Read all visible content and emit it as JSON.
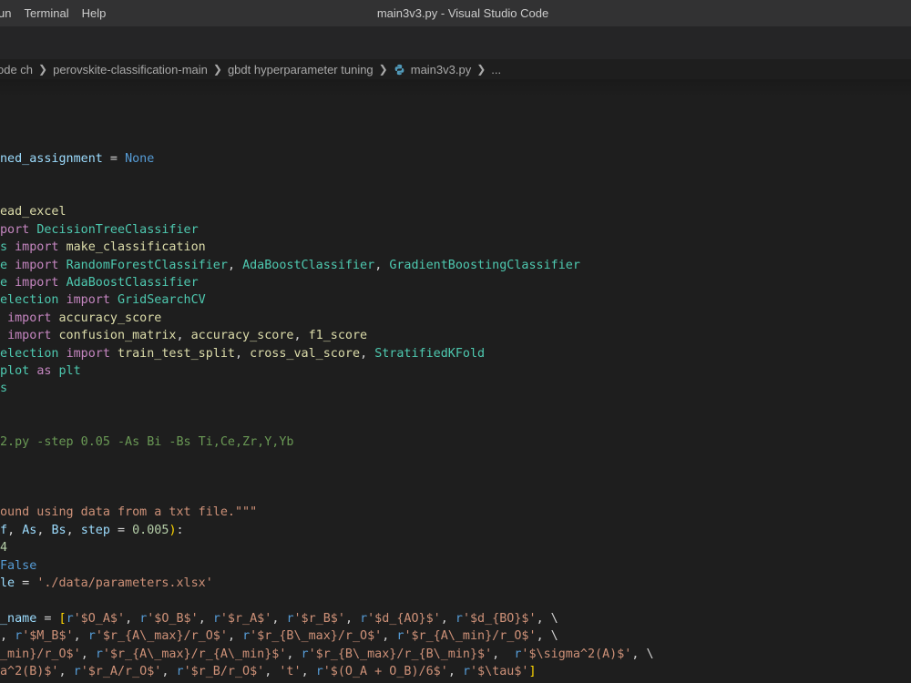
{
  "menu": {
    "items": [
      "un",
      "Terminal",
      "Help"
    ]
  },
  "window": {
    "title": "main3v3.py - Visual Studio Code"
  },
  "breadcrumb": {
    "items": [
      "ode ch",
      "perovskite-classification-main",
      "gbdt hyperparameter tuning",
      "main3v3.py",
      "..."
    ],
    "file_icon": "python-icon"
  },
  "colors": {
    "background": "#1e1e1e",
    "titlebar": "#323233",
    "keyword": "#c586c0",
    "class": "#4ec9b0",
    "string": "#ce9178",
    "number": "#b5cea8",
    "comment": "#6a9955",
    "constant": "#569cd6",
    "variable": "#9cdcfe",
    "function": "#dcdcaa"
  },
  "code": {
    "l1": [
      "ned_assignment",
      " = ",
      "None"
    ],
    "l2": [
      "ead_excel"
    ],
    "l3": [
      "port",
      " ",
      "DecisionTreeClassifier"
    ],
    "l4": [
      "s",
      " ",
      "import",
      " ",
      "make_classification"
    ],
    "l5": [
      "e",
      " ",
      "import",
      " ",
      "RandomForestClassifier",
      ", ",
      "AdaBoostClassifier",
      ", ",
      "GradientBoostingClassifier"
    ],
    "l6": [
      "e",
      " ",
      "import",
      " ",
      "AdaBoostClassifier"
    ],
    "l7": [
      "election",
      " ",
      "import",
      " ",
      "GridSearchCV"
    ],
    "l8": [
      " ",
      "import",
      " ",
      "accuracy_score"
    ],
    "l9": [
      " ",
      "import",
      " ",
      "confusion_matrix",
      ", ",
      "accuracy_score",
      ", ",
      "f1_score"
    ],
    "l10": [
      "election",
      " ",
      "import",
      " ",
      "train_test_split",
      ", ",
      "cross_val_score",
      ", ",
      "StratifiedKFold"
    ],
    "l11": [
      "plot",
      " ",
      "as",
      " ",
      "plt"
    ],
    "l12": [
      "s"
    ],
    "l13": [
      "2.py -step 0.05 -As Bi -Bs Ti,Ce,Zr,Y,Yb"
    ],
    "l14": [
      "ound using data from a txt file.\"\"\""
    ],
    "l15": [
      "f",
      ", ",
      "As",
      ", ",
      "Bs",
      ", ",
      "step",
      " = ",
      "0.005",
      ")",
      ":"
    ],
    "l16": [
      "4"
    ],
    "l17": [
      "False"
    ],
    "l18": [
      "le",
      " = ",
      "'./data/parameters.xlsx'"
    ],
    "l19": [
      "_name",
      " = ",
      "[",
      "r",
      "'$O_A$'",
      ", ",
      "r",
      "'$O_B$'",
      ", ",
      "r",
      "'$r_A$'",
      ", ",
      "r",
      "'$r_B$'",
      ", ",
      "r",
      "'$d_{AO}$'",
      ", ",
      "r",
      "'$d_{BO}$'",
      ", \\"
    ],
    "l20": [
      ", ",
      "r",
      "'$M_B$'",
      ", ",
      "r",
      "'$r_{A\\_max}/r_O$'",
      ", ",
      "r",
      "'$r_{B\\_max}/r_O$'",
      ", ",
      "r",
      "'$r_{A\\_min}/r_O$'",
      ", \\"
    ],
    "l21": [
      "_min}/r_O$'",
      ", ",
      "r",
      "'$r_{A\\_max}/r_{A\\_min}$'",
      ", ",
      "r",
      "'$r_{B\\_max}/r_{B\\_min}$'",
      ",  ",
      "r",
      "'$\\sigma^2(A)$'",
      ", \\"
    ],
    "l22": [
      "a^2(B)$'",
      ", ",
      "r",
      "'$r_A/r_O$'",
      ", ",
      "r",
      "'$r_B/r_O$'",
      ", ",
      "'t'",
      ", ",
      "r",
      "'$(O_A + O_B)/6$'",
      ", ",
      "r",
      "'$\\tau$'",
      "]"
    ]
  }
}
